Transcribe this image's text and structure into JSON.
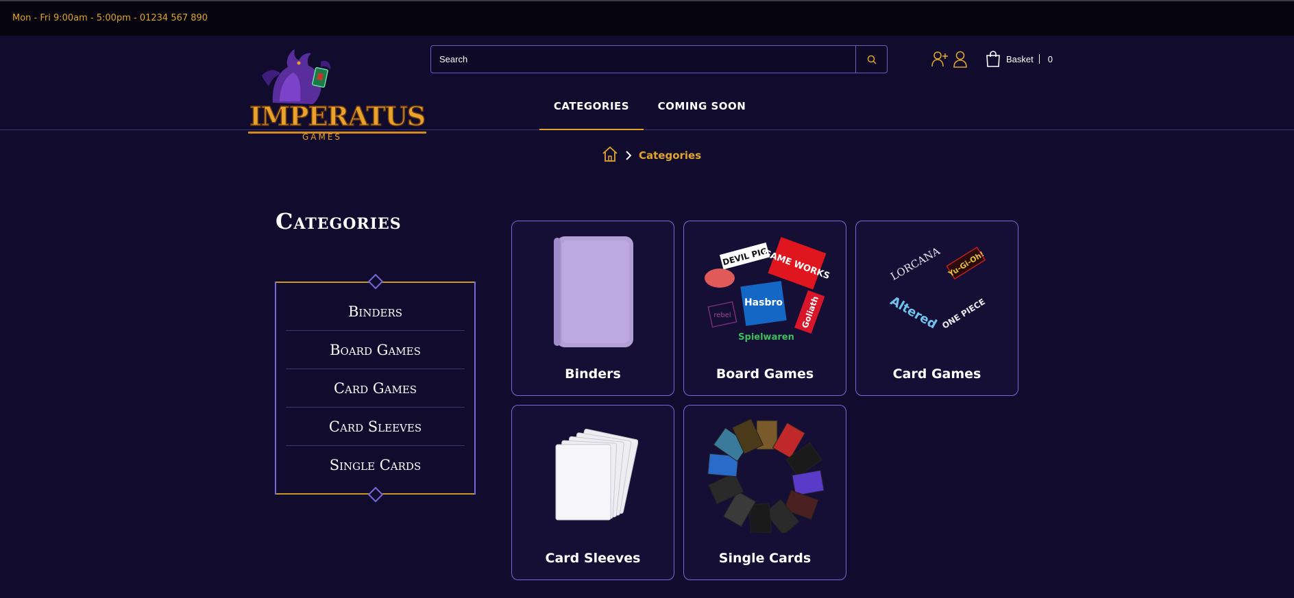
{
  "topbar": {
    "hours": "Mon - Fri 9:00am - 5:00pm - 01234 567 890"
  },
  "logo": {
    "main": "IMPERATUS",
    "sub": "GAMES"
  },
  "search": {
    "placeholder": "Search"
  },
  "basket": {
    "label": "Basket",
    "count": "0"
  },
  "nav": {
    "items": [
      {
        "label": "CATEGORIES"
      },
      {
        "label": "COMING SOON"
      }
    ]
  },
  "breadcrumb": {
    "current": "Categories"
  },
  "page": {
    "title": "Categories"
  },
  "sidebar": {
    "items": [
      {
        "label": "Binders"
      },
      {
        "label": "Board Games"
      },
      {
        "label": "Card Games"
      },
      {
        "label": "Card Sleeves"
      },
      {
        "label": "Single Cards"
      }
    ]
  },
  "cards": [
    {
      "label": "Binders"
    },
    {
      "label": "Board Games"
    },
    {
      "label": "Card Games"
    },
    {
      "label": "Card Sleeves"
    },
    {
      "label": "Single Cards"
    }
  ],
  "brand_logos": {
    "board_games": [
      "DEVIL PIG",
      "GAME WORKS",
      "Hasbro",
      "Goliath",
      "rebel",
      "Spielwaren"
    ],
    "card_games": [
      "LORCANA",
      "Yu-Gi-Oh!",
      "Altered",
      "ONE PIECE"
    ]
  },
  "colors": {
    "background": "#110b2e",
    "topbar": "#06040f",
    "accent": "#e0a52a",
    "border": "#7b68d8"
  },
  "icons": {
    "search": "search-icon",
    "register": "user-plus-icon",
    "account": "user-icon",
    "basket": "shopping-bag-icon",
    "home": "home-icon",
    "chevron": "chevron-right-icon"
  }
}
